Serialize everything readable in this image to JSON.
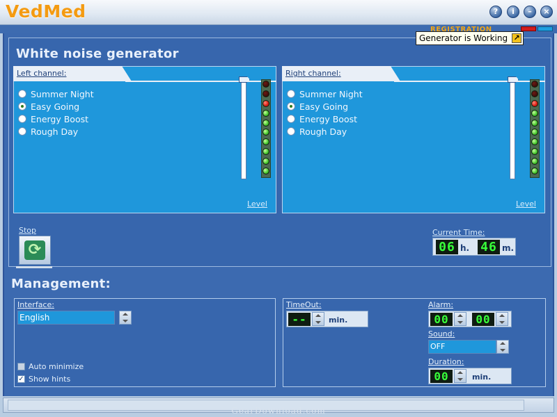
{
  "app": {
    "title": "VedMed"
  },
  "window_buttons": {
    "help": "?",
    "info": "i",
    "minimize": "–",
    "close": "×"
  },
  "registration": {
    "label": "REGISTRATION"
  },
  "tooltip": {
    "text": "Generator is Working"
  },
  "white_noise": {
    "title": "White noise generator",
    "left_channel": {
      "label": "Left channel:",
      "options": [
        "Summer Night",
        "Easy Going",
        "Energy Boost",
        "Rough Day"
      ],
      "selected": "Easy Going",
      "level_label": "Level",
      "leds_lit_red": 1,
      "leds_lit_green": 8,
      "leds_dark": 2
    },
    "right_channel": {
      "label": "Right channel:",
      "options": [
        "Summer Night",
        "Easy Going",
        "Energy Boost",
        "Rough Day"
      ],
      "selected": "Easy Going",
      "level_label": "Level",
      "leds_lit_red": 1,
      "leds_lit_green": 8,
      "leds_dark": 2
    },
    "stop_label": "Stop",
    "current_time": {
      "label": "Current Time:",
      "hours": "06",
      "hours_unit": "h.",
      "minutes": "46",
      "minutes_unit": "m."
    }
  },
  "management": {
    "title": "Management:",
    "interface": {
      "label": "Interface:",
      "value": "English"
    },
    "auto_minimize": {
      "label": "Auto minimize",
      "checked": false
    },
    "show_hints": {
      "label": "Show hints",
      "checked": true
    },
    "timeout": {
      "label": "TimeOut:",
      "value": "--",
      "unit": "min."
    },
    "alarm": {
      "label": "Alarm:",
      "hours": "00",
      "minutes": "00"
    },
    "sound": {
      "label": "Sound:",
      "value": "OFF"
    },
    "duration": {
      "label": "Duration:",
      "value": "00",
      "unit": "min."
    }
  },
  "watermark": "GearDownload.com",
  "colors": {
    "accent_orange": "#f49b12",
    "panel_blue": "#3766ad",
    "channel_blue": "#1f97db",
    "lcd_green": "#38ff3a"
  }
}
